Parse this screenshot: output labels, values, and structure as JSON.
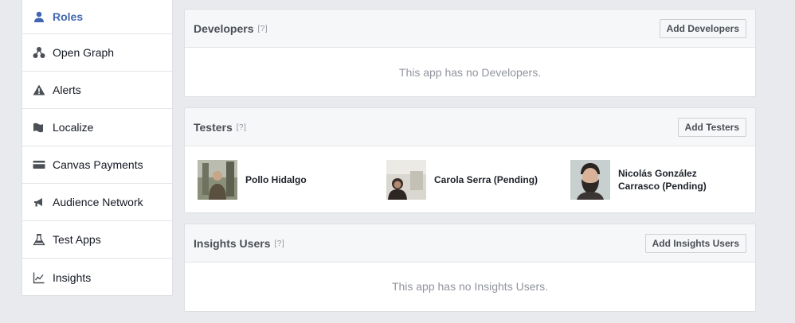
{
  "sidebar": {
    "items": [
      {
        "label": "Roles",
        "icon": "person-icon"
      },
      {
        "label": "Open Graph",
        "icon": "graph-nodes-icon"
      },
      {
        "label": "Alerts",
        "icon": "warning-icon"
      },
      {
        "label": "Localize",
        "icon": "flag-icon"
      },
      {
        "label": "Canvas Payments",
        "icon": "credit-card-icon"
      },
      {
        "label": "Audience Network",
        "icon": "megaphone-icon"
      },
      {
        "label": "Test Apps",
        "icon": "flask-icon"
      },
      {
        "label": "Insights",
        "icon": "line-chart-icon"
      }
    ]
  },
  "developers": {
    "title": "Developers",
    "help": "[?]",
    "button": "Add Developers",
    "empty": "This app has no Developers."
  },
  "testers": {
    "title": "Testers",
    "help": "[?]",
    "button": "Add Testers",
    "people": [
      {
        "name": "Pollo Hidalgo"
      },
      {
        "name": "Carola Serra (Pending)"
      },
      {
        "name": "Nicolás González Carrasco (Pending)"
      }
    ]
  },
  "insights_users": {
    "title": "Insights Users",
    "help": "[?]",
    "button": "Add Insights Users",
    "empty": "This app has no Insights Users."
  },
  "colors": {
    "accent": "#4267b2",
    "background": "#e9eaed",
    "muted_text": "#90949c"
  }
}
